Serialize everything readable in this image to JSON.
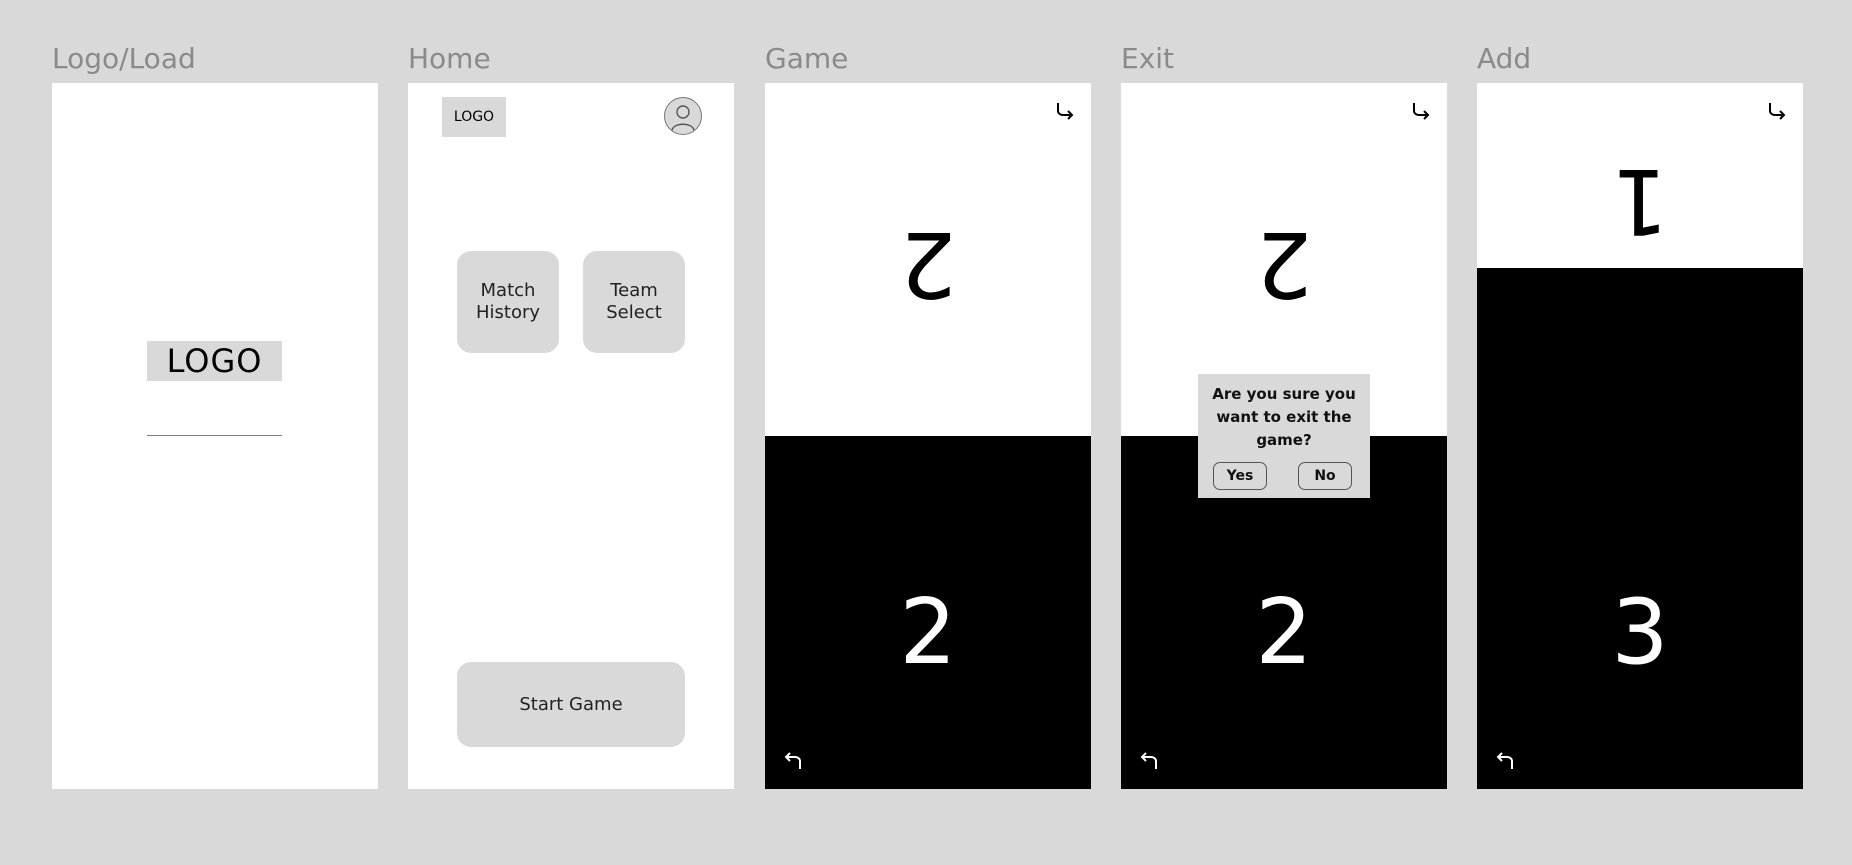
{
  "frames": {
    "load": {
      "title": "Logo/Load",
      "logo": "LOGO"
    },
    "home": {
      "title": "Home",
      "logo": "LOGO",
      "match_history": "Match\nHistory",
      "team_select": "Team\nSelect",
      "start_game": "Start Game"
    },
    "game": {
      "title": "Game",
      "top_score": "2",
      "bottom_score": "2"
    },
    "exit": {
      "title": "Exit",
      "top_score": "2",
      "bottom_score": "2",
      "dialog_text": "Are you sure you want to exit the game?",
      "yes": "Yes",
      "no": "No"
    },
    "add": {
      "title": "Add",
      "top_score": "1",
      "bottom_score": "3"
    }
  }
}
